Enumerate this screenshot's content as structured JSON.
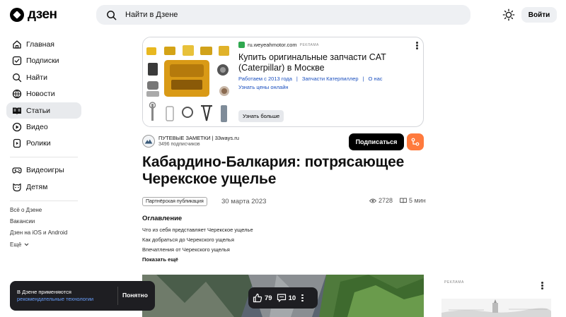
{
  "header": {
    "logo_text": "дзен",
    "search_placeholder": "Найти в Дзене",
    "login_label": "Войти"
  },
  "sidebar": {
    "items": [
      {
        "label": "Главная",
        "icon": "home-icon"
      },
      {
        "label": "Подписки",
        "icon": "subscriptions-icon"
      },
      {
        "label": "Найти",
        "icon": "search-icon"
      },
      {
        "label": "Новости",
        "icon": "news-icon"
      },
      {
        "label": "Статьи",
        "icon": "articles-icon",
        "active": true
      },
      {
        "label": "Видео",
        "icon": "video-icon"
      },
      {
        "label": "Ролики",
        "icon": "shorts-icon"
      },
      {
        "label": "Видеоигры",
        "icon": "gamepad-icon"
      },
      {
        "label": "Детям",
        "icon": "kids-icon"
      }
    ],
    "footer_links": [
      "Всё о Дзене",
      "Вакансии",
      "Дзен на iOS и Android",
      "Ещё"
    ]
  },
  "ad": {
    "domain": "ru.weyeahmotor.com",
    "tag": "РЕКЛАМА",
    "title": "Купить оригинальные запчасти CAT (Caterpillar) в Москве",
    "links": [
      "Работаем с 2013 года",
      "Запчасти Катерпиллер",
      "О нас"
    ],
    "cta_link": "Узнать цены онлайн",
    "button": "Узнать больше"
  },
  "channel": {
    "name": "ПУТЕВЫЕ ЗАМЕТКИ | 33ways.ru",
    "subscribers": "3496 подписчиков",
    "subscribe_label": "Подписаться"
  },
  "article": {
    "title": "Кабардино-Балкария: потрясающее Черекское ущелье",
    "badge": "Партнёрская публикация",
    "date": "30 марта 2023",
    "views": "2728",
    "read_time": "5 мин",
    "toc_heading": "Оглавление",
    "toc": [
      "Что из себя представляет Черекское ущелье",
      "Как добраться до Черекского ущелья",
      "Впечатления от Черекского ущелья"
    ],
    "toc_more": "Показать ещё"
  },
  "right_ad": {
    "tag": "РЕКЛАМА"
  },
  "toast": {
    "text": "В Дзене применяются",
    "link": "рекомендательные технологии",
    "button": "Понятно"
  },
  "reactions": {
    "likes": "79",
    "comments": "10"
  },
  "colors": {
    "accent": "#ff7a3d",
    "dark": "#1e1e22",
    "link": "#1a4fbf",
    "surface": "#eef0f3"
  }
}
